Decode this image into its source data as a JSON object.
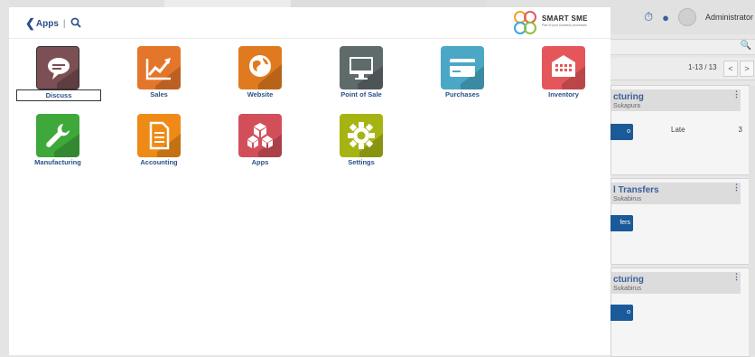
{
  "header": {
    "back_label": "Apps",
    "separator": "|",
    "search_icon": "search-icon",
    "logo_text": "SMART SME",
    "logo_tagline": "Part of your business processes"
  },
  "apps": [
    {
      "label": "Discuss",
      "icon": "chat-icon",
      "color": "#7b4f53",
      "selected": true
    },
    {
      "label": "Sales",
      "icon": "trend-chart-icon",
      "color": "#e4762b"
    },
    {
      "label": "Website",
      "icon": "globe-icon",
      "color": "#e07a1f"
    },
    {
      "label": "Point of Sale",
      "icon": "monitor-icon",
      "color": "#5f6a6b"
    },
    {
      "label": "Purchases",
      "icon": "card-icon",
      "color": "#4aa8c6"
    },
    {
      "label": "Inventory",
      "icon": "warehouse-icon",
      "color": "#e5565b"
    },
    {
      "label": "Manufacturing",
      "icon": "wrench-icon",
      "color": "#3ea83b"
    },
    {
      "label": "Accounting",
      "icon": "document-icon",
      "color": "#ef8a16"
    },
    {
      "label": "Apps",
      "icon": "cubes-icon",
      "color": "#d24f5a"
    },
    {
      "label": "Settings",
      "icon": "gear-icon",
      "color": "#a6b413"
    }
  ],
  "background": {
    "user_name": "Administrator",
    "pager_text": "1-13 / 13",
    "prev": "<",
    "next": ">",
    "cards": [
      {
        "title": "cturing",
        "sub": "Sukapura",
        "button": "o",
        "late_label": "Late",
        "late_count": "3"
      },
      {
        "title": "l Transfers",
        "sub": "Sukabirus",
        "button": "fers"
      },
      {
        "title": "cturing",
        "sub": "Sukabirus",
        "button": "o"
      }
    ]
  }
}
